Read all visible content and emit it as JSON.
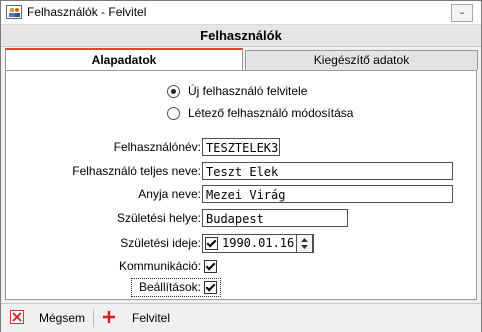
{
  "window": {
    "title": "Felhasználók - Felvitel",
    "min_symbol": "–"
  },
  "header": {
    "title": "Felhasználók"
  },
  "tabs": [
    {
      "label": "Alapadatok",
      "active": true
    },
    {
      "label": "Kiegészítő adatok",
      "active": false
    }
  ],
  "mode": {
    "options": [
      {
        "label": "Új felhasználó felvitele",
        "selected": true
      },
      {
        "label": "Létező felhasználó módosítása",
        "selected": false
      }
    ]
  },
  "form": {
    "username_label": "Felhasználónév:",
    "username_value": "TESZTELEK3",
    "fullname_label": "Felhasználó teljes neve:",
    "fullname_value": "Teszt Elek",
    "mother_label": "Anyja neve:",
    "mother_value": "Mezei Virág",
    "birthplace_label": "Születési helye:",
    "birthplace_value": "Budapest",
    "birthdate_label": "Születési ideje:",
    "birthdate_value": "1990.01.16",
    "birthdate_checked": true,
    "communication_label": "Kommunikáció:",
    "communication_checked": true,
    "settings_label": "Beállítások:",
    "settings_checked": true
  },
  "toolbar": {
    "cancel_label": "Mégsem",
    "add_label": "Felvitel"
  },
  "colors": {
    "accent": "#d94a2a",
    "cancel_icon": "#c0392b",
    "add_icon": "#d0201a"
  }
}
